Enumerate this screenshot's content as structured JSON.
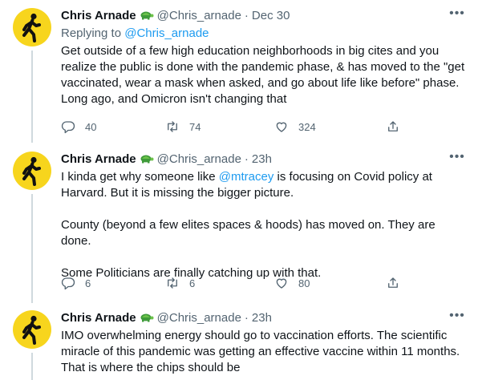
{
  "tweets": [
    {
      "name": "Chris Arnade",
      "handle": "@Chris_arnade",
      "separator": "·",
      "time": "Dec 30",
      "replying_prefix": "Replying to ",
      "replying_to": "@Chris_arnade",
      "text_lines": [
        "Get outside of a few high education neighborhoods in big cites and you",
        "realize the public is done with the pandemic phase, & has moved to the \"get",
        "vaccinated, wear a mask when asked, and go about life like before\" phase.",
        "Long ago, and Omicron isn't changing that"
      ],
      "replies": "40",
      "retweets": "74",
      "likes": "324"
    },
    {
      "name": "Chris Arnade",
      "handle": "@Chris_arnade",
      "separator": "·",
      "time": "23h",
      "line1_prefix": "I kinda get why someone like ",
      "line1_mention": "@mtracey",
      "line1_suffix": " is focusing on Covid policy at",
      "line2": "Harvard. But it is missing the bigger picture.",
      "para2": "County (beyond a few elites spaces & hoods) has moved on. They are done.",
      "para3": "Some Politicians are finally catching up with that.",
      "replies": "6",
      "retweets": "6",
      "likes": "80"
    },
    {
      "name": "Chris Arnade",
      "handle": "@Chris_arnade",
      "separator": "·",
      "time": "23h",
      "text_lines": [
        "IMO overwhelming energy should go to vaccination efforts. The scientific",
        "miracle of this pandemic was getting an effective vaccine within 11 months.",
        "That is where the chips should be"
      ]
    }
  ],
  "icons": {
    "avatar": "walking-figure-sign",
    "badge": "turtle-emoji",
    "more": "more-dots-icon",
    "reply": "reply-icon",
    "retweet": "retweet-icon",
    "like": "heart-icon",
    "share": "share-icon"
  },
  "colors": {
    "accent": "#1d9bf0",
    "avatar_bg": "#f7d51d",
    "muted": "#536471",
    "text": "#0f1419",
    "thread_line": "#cfd9de"
  }
}
